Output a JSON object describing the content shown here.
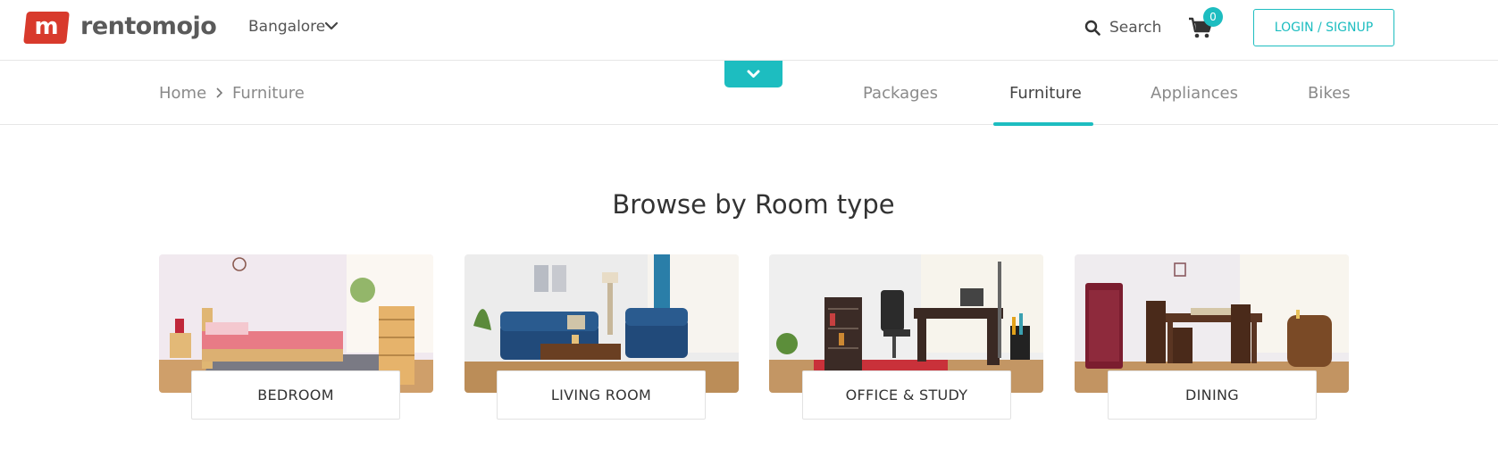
{
  "header": {
    "logo_letter": "m",
    "brand_name": "rentomojo",
    "city": "Bangalore",
    "search_label": "Search",
    "cart_count": "0",
    "login_label": "LOGIN / SIGNUP"
  },
  "breadcrumb": {
    "home": "Home",
    "current": "Furniture"
  },
  "nav": {
    "items": [
      {
        "label": "Packages"
      },
      {
        "label": "Furniture"
      },
      {
        "label": "Appliances"
      },
      {
        "label": "Bikes"
      }
    ]
  },
  "section": {
    "title": "Browse by Room type"
  },
  "rooms": [
    {
      "label": "BEDROOM"
    },
    {
      "label": "LIVING ROOM"
    },
    {
      "label": "OFFICE & STUDY"
    },
    {
      "label": "DINING"
    }
  ],
  "colors": {
    "brand_red": "#d83a2c",
    "accent_teal": "#1dbdc0"
  }
}
